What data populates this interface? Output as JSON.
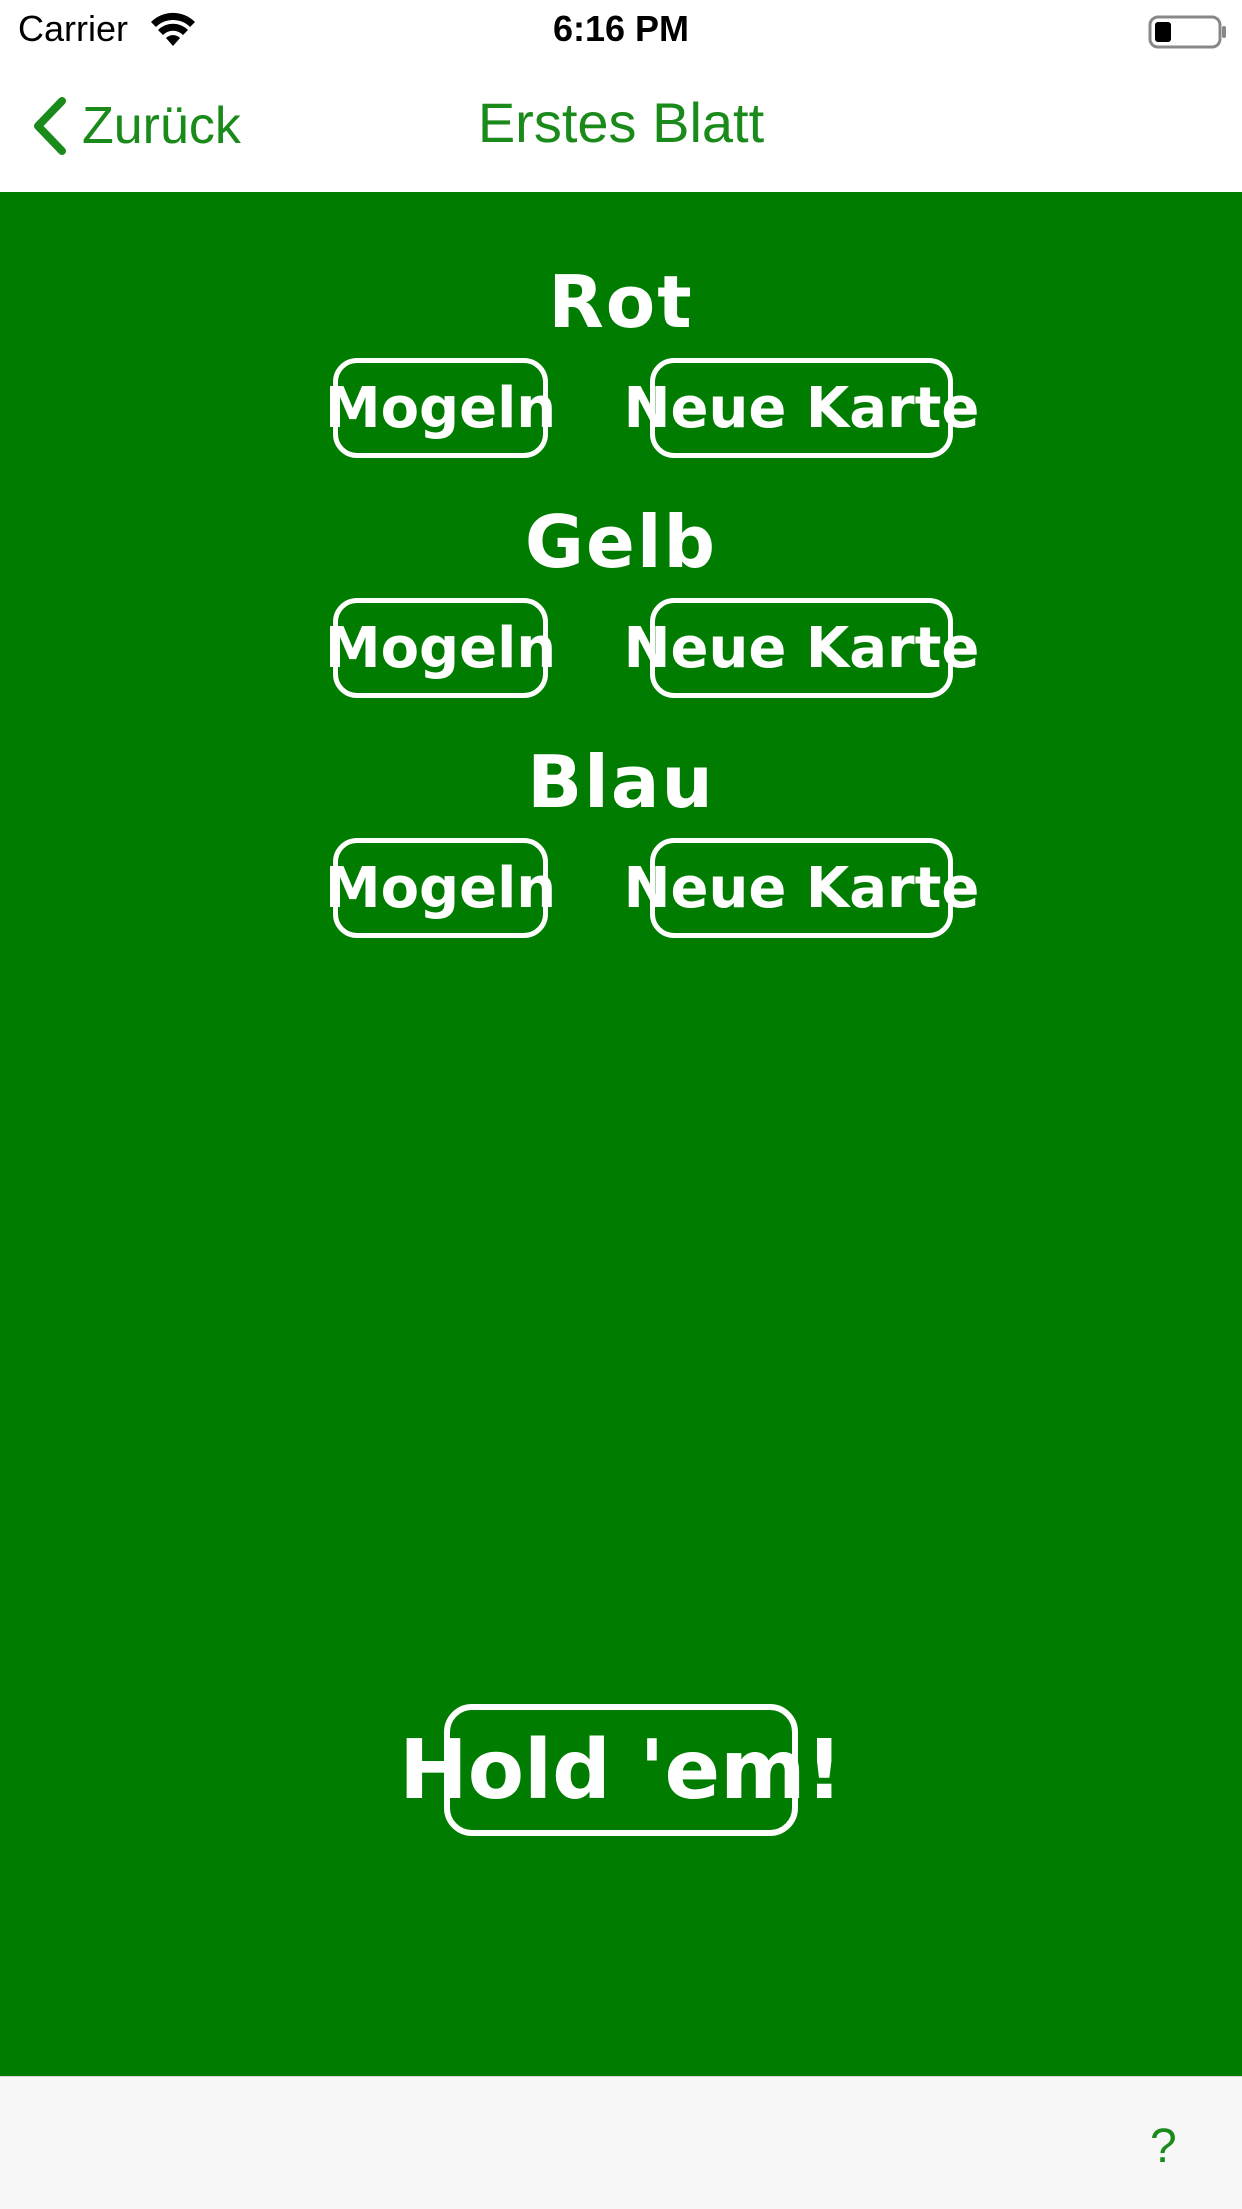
{
  "status_bar": {
    "carrier": "Carrier",
    "time": "6:16 PM",
    "wifi_icon": "wifi-icon",
    "battery_icon": "battery-low-icon"
  },
  "nav": {
    "back_label": "Zurück",
    "title": "Erstes Blatt",
    "accent_color": "#1a8a1a"
  },
  "game": {
    "background_color": "#007d00",
    "sections": [
      {
        "label": "Rot",
        "cheat_label": "Mogeln",
        "new_card_label": "Neue Karte"
      },
      {
        "label": "Gelb",
        "cheat_label": "Mogeln",
        "new_card_label": "Neue Karte"
      },
      {
        "label": "Blau",
        "cheat_label": "Mogeln",
        "new_card_label": "Neue Karte"
      }
    ],
    "hold_label": "Hold 'em!"
  },
  "toolbar": {
    "help_label": "?"
  }
}
